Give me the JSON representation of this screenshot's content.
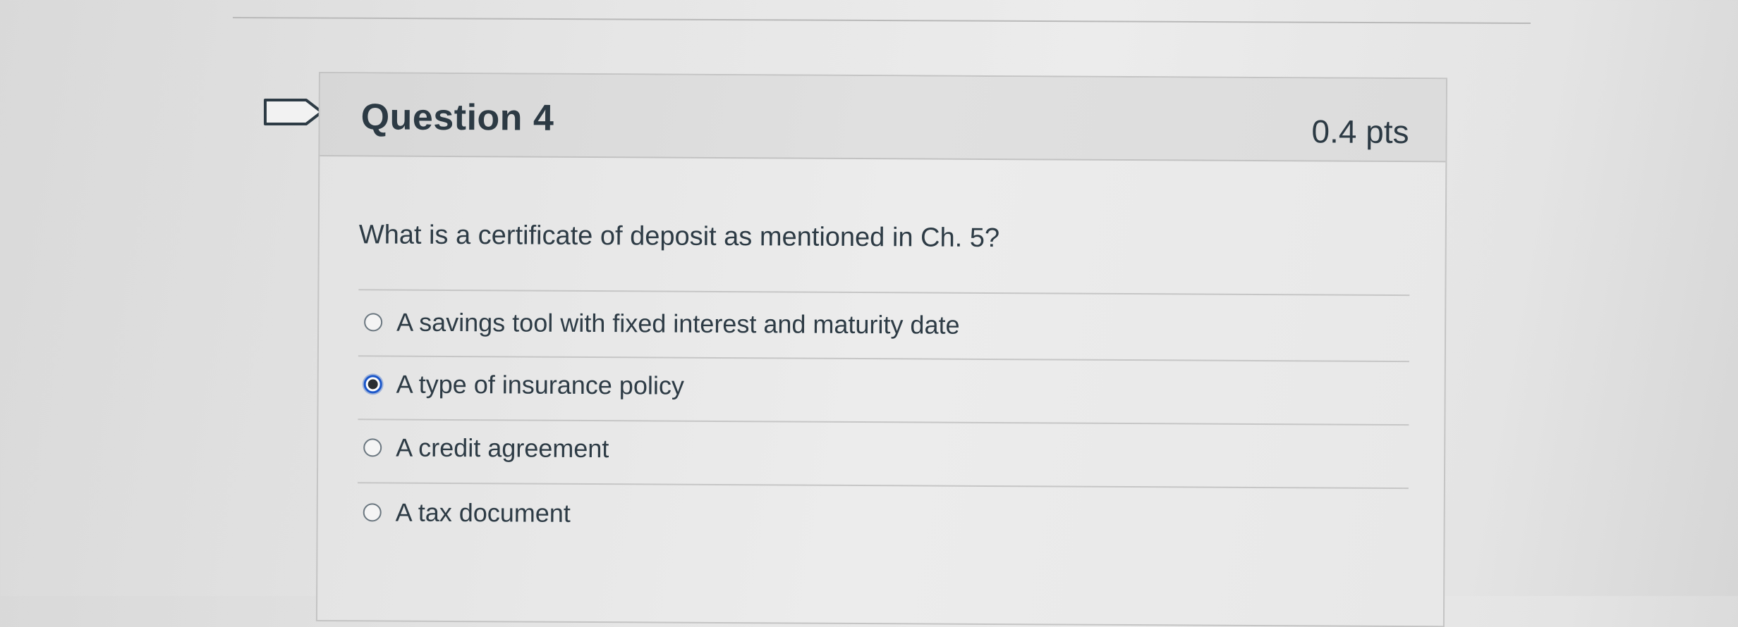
{
  "question": {
    "title": "Question 4",
    "points": "0.4 pts",
    "text": "What is a certificate of deposit as mentioned in Ch. 5?",
    "answers": [
      {
        "label": "A savings tool with fixed interest and maturity date",
        "selected": false
      },
      {
        "label": "A type of insurance policy",
        "selected": true
      },
      {
        "label": "A credit agreement",
        "selected": false
      },
      {
        "label": "A tax document",
        "selected": false
      }
    ]
  },
  "colors": {
    "selected_radio": "#1a56c9",
    "text": "#2d3b45",
    "header_bg": "#dcdcdc"
  },
  "icons": {
    "flag": "bookmark-flag-icon"
  }
}
